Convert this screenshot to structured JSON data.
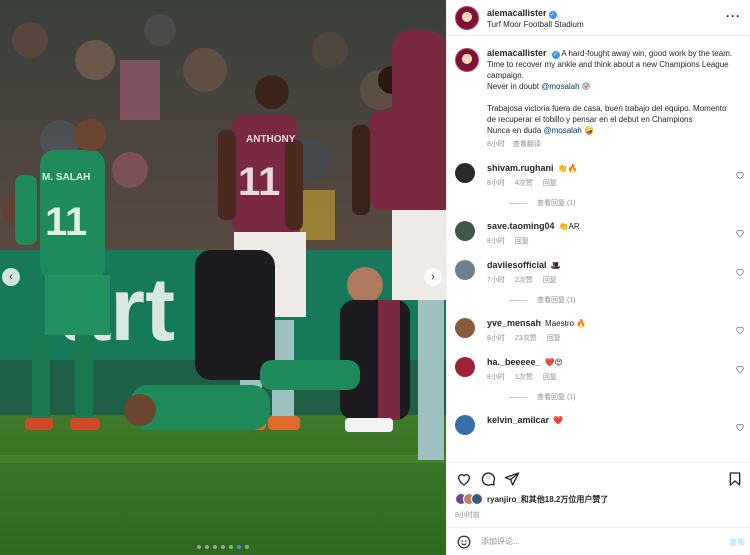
{
  "colors": {
    "accent": "#3897f0",
    "like_red": "#ed4956",
    "muted": "#8e8e8e",
    "link": "#00376b"
  },
  "photo": {
    "description_icon": "football-match-photo",
    "jersey_back_name": "M. SALAH",
    "jersey_back_number": "11",
    "player_name_short": "ANTHONY",
    "player_number": "11",
    "board_text": "art",
    "carousel_dots": 7,
    "active_dot": 5
  },
  "header": {
    "username": "alemacallister",
    "location": "Turf Moor Football Stadium",
    "more_icon": "more-horizontal-icon"
  },
  "caption": {
    "username": "alemacallister",
    "line1": "A hard-fought away win, good work by the team. Time to recover my ankle and think about a new Champions League campaign.",
    "line2_prefix": "Never in doubt",
    "mention": "@mosalah",
    "line2_emoji": "😜",
    "es_line1": "Trabajosa victoria fuera de casa, buen trabajo del equipo. Momento de recuperar el tobillo y pensar en el debut en Champions",
    "es_line2_prefix": "Nunca en duda",
    "es_emoji": "🤪",
    "time": "8小时",
    "translate": "查看翻译"
  },
  "comments": [
    {
      "username": "shivam.rughani",
      "text": "👏🔥",
      "time": "8小时",
      "likes": "4次赞",
      "reply": "回复",
      "view_replies": "查看回复 (1)",
      "avatar_color": "#2a2a2a"
    },
    {
      "username": "save.taoming04",
      "text": "👏AR",
      "time": "8小时",
      "likes": "",
      "reply": "回复",
      "view_replies": "",
      "avatar_color": "#3d5a48"
    },
    {
      "username": "daviiesofficial",
      "text": "🎩",
      "time": "7小时",
      "likes": "2次赞",
      "reply": "回复",
      "view_replies": "查看回复 (1)",
      "avatar_color": "#6f7f8f"
    },
    {
      "username": "yve_mensah",
      "text": "Maestro 🔥",
      "time": "8小时",
      "likes": "23次赞",
      "reply": "回复",
      "view_replies": "",
      "avatar_color": "#8a5a3c"
    },
    {
      "username": "ha._beeeee_",
      "text": "❤️😍",
      "time": "8小时",
      "likes": "1次赞",
      "reply": "回复",
      "view_replies": "查看回复 (1)",
      "avatar_color": "#a0203a"
    },
    {
      "username": "kelvin_amilcar",
      "text": "❤️",
      "time": "",
      "likes": "",
      "reply": "",
      "view_replies": "",
      "avatar_color": "#3a6ea8"
    }
  ],
  "actions": {
    "like_icon": "heart-icon",
    "comment_icon": "comment-icon",
    "share_icon": "send-icon",
    "save_icon": "bookmark-icon"
  },
  "likes_text": "ryanjiro_和其他18.2万位用户赞了",
  "post_time": "8小时前",
  "comment_box": {
    "placeholder": "添加评论...",
    "post_label": "发布",
    "emoji_icon": "smiley-icon"
  }
}
